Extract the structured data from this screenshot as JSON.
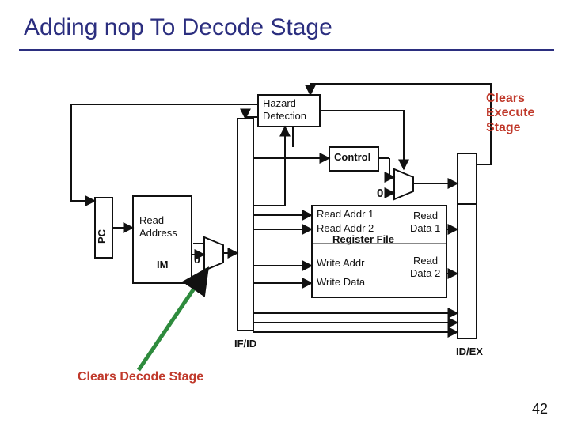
{
  "title": "Adding nop To Decode Stage",
  "page": "42",
  "labels": {
    "hazard_l1": "Hazard",
    "hazard_l2": "Detection",
    "control": "Control",
    "zero_top": "0",
    "pc": "PC",
    "read_addr_label": "Read",
    "read_addr_label2": "Address",
    "im": "IM",
    "zero_mux": "0",
    "ra1": "Read Addr 1",
    "ra2": "Read Addr 2",
    "wa": "Write Addr",
    "wd": "Write Data",
    "rd1a": "Read",
    "rd1b": "Data 1",
    "rd2a": "Read",
    "rd2b": "Data 2",
    "regfile": "Register File",
    "ifid": "IF/ID",
    "idex": "ID/EX",
    "clears_exec": "Clears Execute Stage",
    "clears_dec": "Clears Decode Stage"
  }
}
